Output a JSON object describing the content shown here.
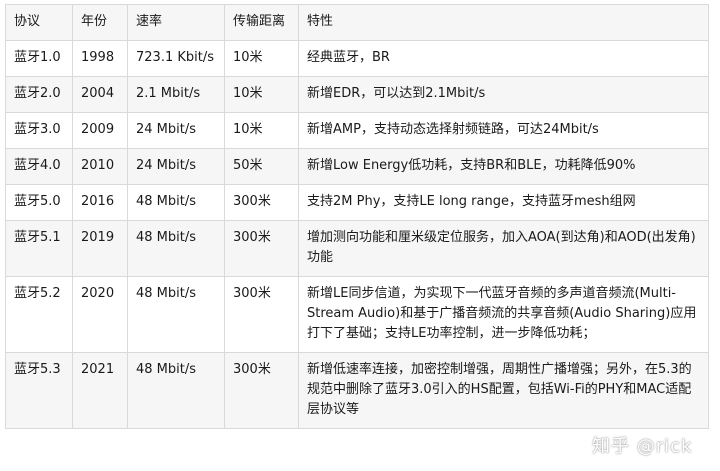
{
  "headers": [
    "协议",
    "年份",
    "速率",
    "传输距离",
    "特性"
  ],
  "rows": [
    [
      "蓝牙1.0",
      "1998",
      "723.1 Kbit/s",
      "10米",
      "经典蓝牙，BR"
    ],
    [
      "蓝牙2.0",
      "2004",
      "2.1 Mbit/s",
      "10米",
      "新增EDR，可以达到2.1Mbit/s"
    ],
    [
      "蓝牙3.0",
      "2009",
      "24 Mbit/s",
      "10米",
      "新增AMP，支持动态选择射频链路，可达24Mbit/s"
    ],
    [
      "蓝牙4.0",
      "2010",
      "24 Mbit/s",
      "50米",
      "新增Low Energy低功耗，支持BR和BLE，功耗降低90%"
    ],
    [
      "蓝牙5.0",
      "2016",
      "48 Mbit/s",
      "300米",
      "支持2M Phy，支持LE long range，支持蓝牙mesh组网"
    ],
    [
      "蓝牙5.1",
      "2019",
      "48 Mbit/s",
      "300米",
      "增加测向功能和厘米级定位服务，加入AOA(到达角)和AOD(出发角)功能"
    ],
    [
      "蓝牙5.2",
      "2020",
      "48 Mbit/s",
      "300米",
      "新增LE同步信道，为实现下一代蓝牙音频的多声道音频流(Multi-Stream Audio)和基于广播音频流的共享音频(Audio Sharing)应用打下了基础；支持LE功率控制，进一步降低功耗；"
    ],
    [
      "蓝牙5.3",
      "2021",
      "48 Mbit/s",
      "300米",
      "新增低速率连接，加密控制增强，周期性广播增强；另外，在5.3的规范中删除了蓝牙3.0引入的HS配置，包括Wi-Fi的PHY和MAC适配层协议等"
    ]
  ],
  "watermark": "知乎 @rick"
}
